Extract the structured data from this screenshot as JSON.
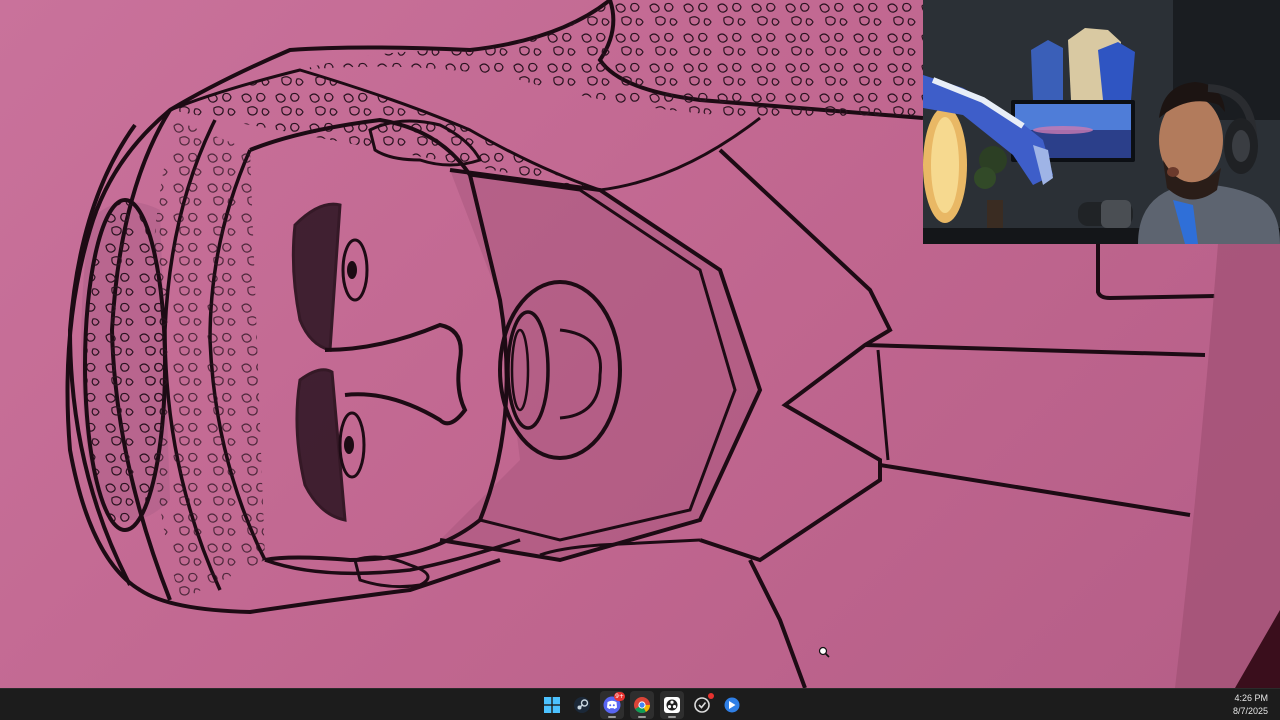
{
  "taskbar": {
    "apps": [
      {
        "name": "start",
        "icon": "windows-logo-icon"
      },
      {
        "name": "steam",
        "icon": "steam-icon"
      },
      {
        "name": "discord",
        "icon": "discord-icon",
        "badge": "9+"
      },
      {
        "name": "chrome",
        "icon": "chrome-icon"
      },
      {
        "name": "obs",
        "icon": "obs-icon"
      },
      {
        "name": "app-6",
        "icon": "app-icon"
      },
      {
        "name": "app-7",
        "icon": "app-icon"
      }
    ],
    "clock": {
      "time": "4:26 PM",
      "date": "8/7/2025"
    }
  },
  "colors": {
    "paper": "#c26a92",
    "ink": "#1d0b14",
    "taskbar": "#1c1c1c"
  }
}
